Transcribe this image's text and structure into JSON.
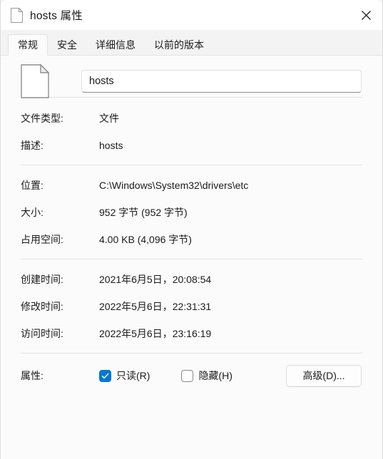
{
  "window": {
    "title": "hosts 属性",
    "icon": "document-icon",
    "close_label": "×"
  },
  "tabs": [
    {
      "label": "常规",
      "selected": true
    },
    {
      "label": "安全",
      "selected": false
    },
    {
      "label": "详细信息",
      "selected": false
    },
    {
      "label": "以前的版本",
      "selected": false
    }
  ],
  "general": {
    "file_icon": "blank-document-icon",
    "filename": "hosts",
    "filename_placeholder": "",
    "sections": [
      {
        "name": "type-section",
        "rows": [
          {
            "label": "文件类型:",
            "value": "文件"
          },
          {
            "label": "描述:",
            "value": "hosts"
          }
        ]
      },
      {
        "name": "location-section",
        "rows": [
          {
            "label": "位置:",
            "value": "C:\\Windows\\System32\\drivers\\etc"
          },
          {
            "label": "大小:",
            "value": "952 字节 (952 字节)"
          },
          {
            "label": "占用空间:",
            "value": "4.00 KB (4,096 字节)"
          }
        ]
      },
      {
        "name": "time-section",
        "rows": [
          {
            "label": "创建时间:",
            "value": "2021年6月5日，20:08:54"
          },
          {
            "label": "修改时间:",
            "value": "2022年5月6日，22:31:31"
          },
          {
            "label": "访问时间:",
            "value": "2022年5月6日，23:16:19"
          }
        ]
      }
    ],
    "attributes": {
      "label": "属性:",
      "readonly": {
        "label": "只读(R)",
        "checked": true
      },
      "hidden": {
        "label": "隐藏(H)",
        "checked": false
      },
      "advanced_button": "高级(D)..."
    }
  },
  "colors": {
    "accent": "#0078d4",
    "window_bg": "#f3f3f3",
    "pane_bg": "#fbfbfb",
    "text": "#1b1b1b",
    "separator": "#e3e3e3"
  }
}
